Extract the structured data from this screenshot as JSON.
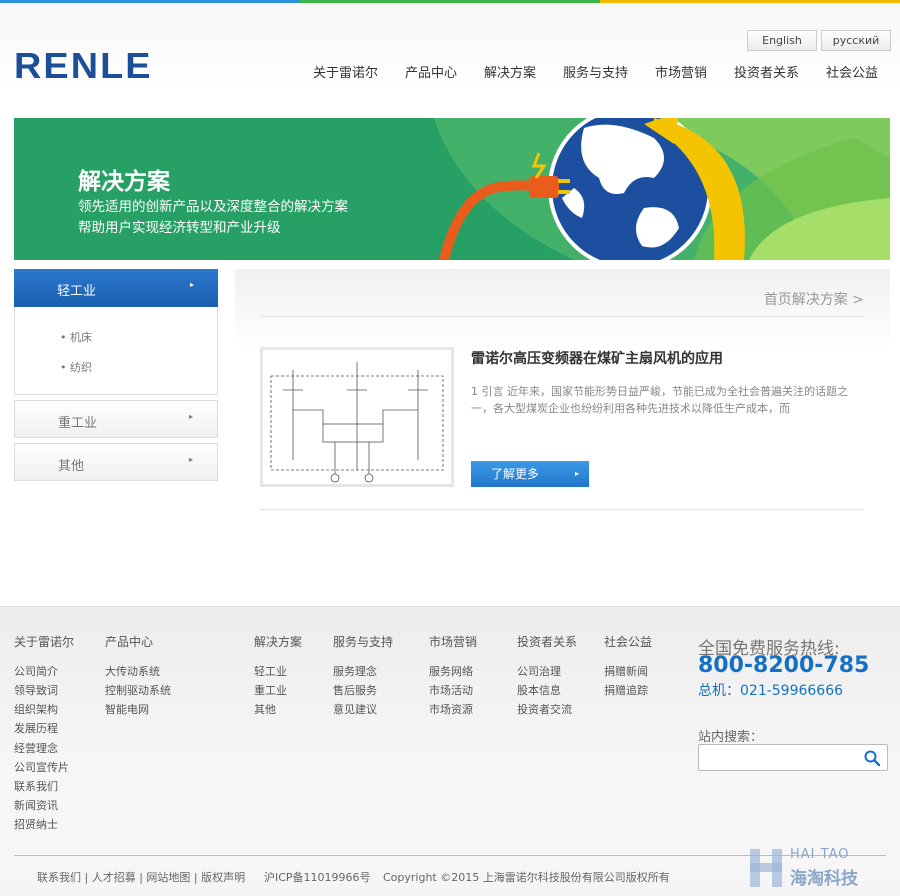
{
  "colors": {
    "brand_blue": "#1d4e9a",
    "banner_green": "#27a066",
    "accent_blue": "#1570c5",
    "bar": [
      "#2b8fd9",
      "#39b54a",
      "#f5b800"
    ]
  },
  "header": {
    "logo": "RENLE",
    "lang": [
      "English",
      "русский"
    ],
    "nav": [
      "关于雷诺尔",
      "产品中心",
      "解决方案",
      "服务与支持",
      "市场营销",
      "投资者关系",
      "社会公益"
    ]
  },
  "banner": {
    "title": "解决方案",
    "line1": "领先适用的创新产品以及深度整合的解决方案",
    "line2": "帮助用户实现经济转型和产业升级"
  },
  "sidebar": {
    "active": "轻工业",
    "sub": [
      "机床",
      "纺织"
    ],
    "items": [
      "重工业",
      "其他"
    ],
    "arrow": "▸"
  },
  "main": {
    "breadcrumb": "首页解决方案 >",
    "article": {
      "title": "雷诺尔高压变频器在煤矿主扇风机的应用",
      "excerpt": "1 引言 近年来，国家节能形势日益严峻，节能已成为全社会普遍关注的话题之一，各大型煤炭企业也纷纷利用各种先进技术以降低生产成本，而",
      "more": "了解更多"
    }
  },
  "footer": {
    "columns": [
      {
        "title": "关于雷诺尔",
        "links": [
          "公司简介",
          "领导致词",
          "组织架构",
          "发展历程",
          "经营理念",
          "公司宣传片",
          "联系我们",
          "新闻资讯",
          "招贤纳士"
        ]
      },
      {
        "title": "产品中心",
        "links": [
          "大传动系统",
          "控制驱动系统",
          "智能电网"
        ]
      },
      {
        "title": "解决方案",
        "links": [
          "轻工业",
          "重工业",
          "其他"
        ]
      },
      {
        "title": "服务与支持",
        "links": [
          "服务理念",
          "售后服务",
          "意见建议"
        ]
      },
      {
        "title": "市场营销",
        "links": [
          "服务网络",
          "市场活动",
          "市场资源"
        ]
      },
      {
        "title": "投资者关系",
        "links": [
          "公司治理",
          "股本信息",
          "投资者交流"
        ]
      },
      {
        "title": "社会公益",
        "links": [
          "捐赠新闻",
          "捐赠追踪"
        ]
      }
    ],
    "hotline_label": "全国免费服务热线:",
    "hotline": "800-8200-785",
    "main_line": "总机：021-59966666",
    "search_label": "站内搜索：",
    "search_placeholder": "",
    "bottom_links": "联系我们 | 人才招募 | 网站地图 | 版权声明",
    "icp": "沪ICP备11019966号",
    "copyright": "Copyright ©2015 上海雷诺尔科技股份有限公司版权所有"
  },
  "watermark": {
    "en": "HAI TAO",
    "cn": "海淘科技"
  }
}
